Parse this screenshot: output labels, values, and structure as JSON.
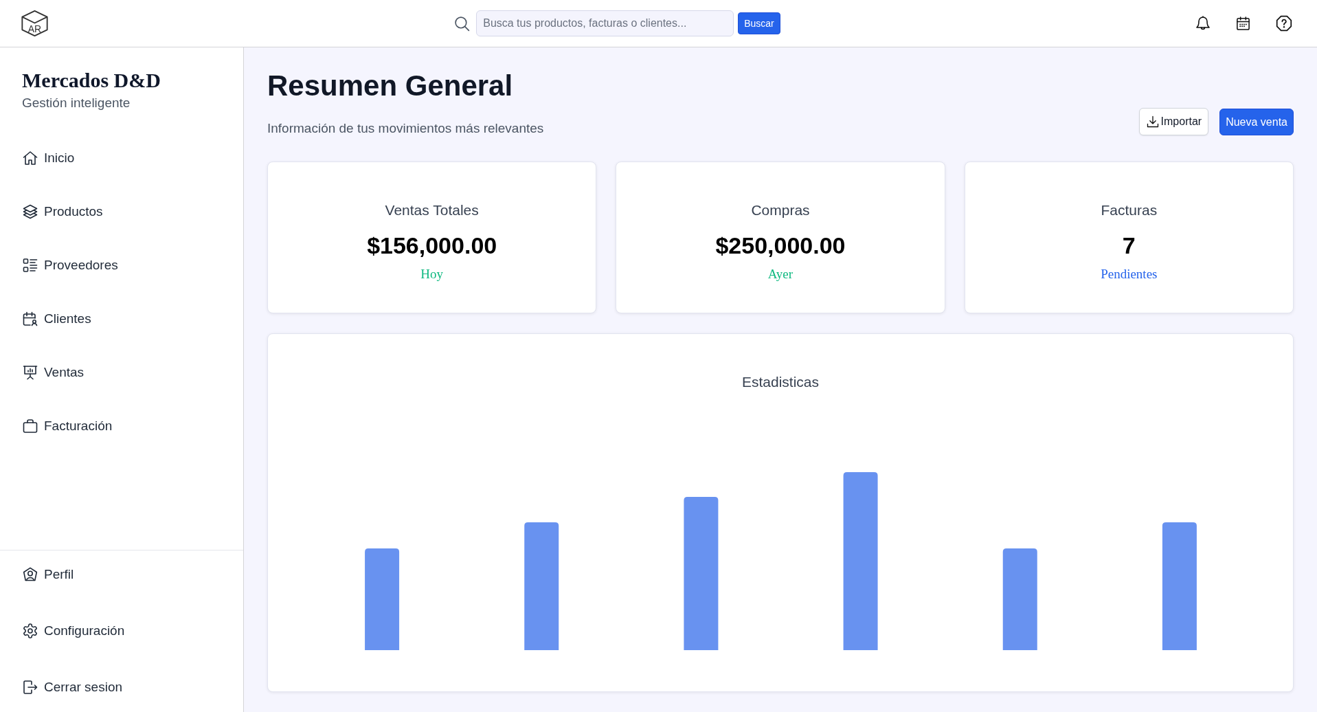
{
  "topbar": {
    "logo": {
      "text": "AR"
    },
    "search": {
      "placeholder": "Busca tus productos, facturas o clientes...",
      "button": "Buscar"
    }
  },
  "sidebar": {
    "title": "Mercados D&D",
    "subtitle": "Gestión inteligente",
    "items": [
      {
        "label": "Inicio"
      },
      {
        "label": "Productos"
      },
      {
        "label": "Proveedores"
      },
      {
        "label": "Clientes"
      },
      {
        "label": "Ventas"
      },
      {
        "label": "Facturación"
      }
    ],
    "footer_items": [
      {
        "label": "Perfil"
      },
      {
        "label": "Configuración"
      },
      {
        "label": "Cerrar sesion"
      }
    ]
  },
  "main": {
    "title": "Resumen General",
    "subtitle": "Información de tus movimientos más relevantes",
    "actions": [
      {
        "label": "Importar",
        "kind": "outline"
      },
      {
        "label": "Nueva venta",
        "kind": "primary"
      }
    ],
    "cards": [
      {
        "label": "Ventas Totales",
        "value": "$156,000.00",
        "note": "Hoy",
        "color": "#10b981"
      },
      {
        "label": "Compras",
        "value": "$250,000.00",
        "note": "Ayer",
        "color": "#10b981"
      },
      {
        "label": "Facturas",
        "value": "7",
        "note": "Pendientes",
        "color": "#2563eb"
      }
    ],
    "chart": {
      "title": "Estadisticas"
    }
  }
}
